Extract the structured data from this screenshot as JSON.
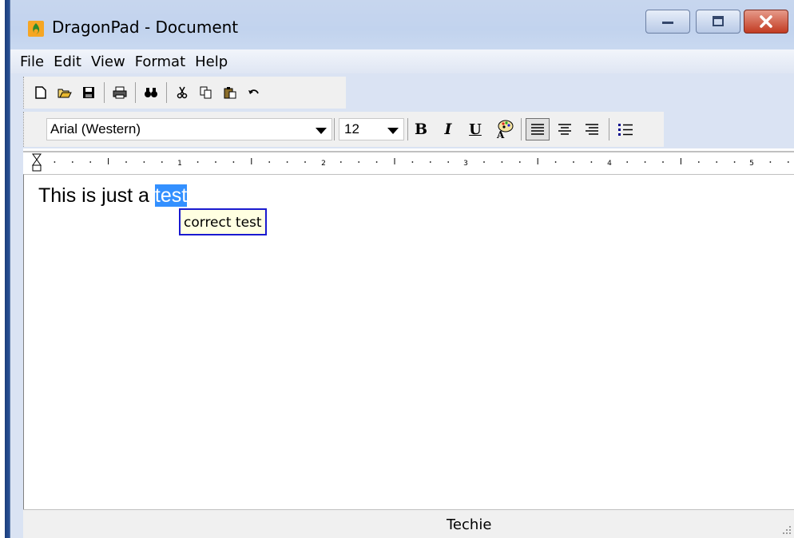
{
  "window": {
    "title": "DragonPad - Document"
  },
  "menu": [
    "File",
    "Edit",
    "View",
    "Format",
    "Help"
  ],
  "toolbar": {
    "icons": [
      "new-file-icon",
      "open-folder-icon",
      "save-icon",
      "print-icon",
      "find-icon",
      "cut-icon",
      "copy-icon",
      "paste-icon",
      "undo-icon"
    ]
  },
  "format_bar": {
    "font_name": "Arial (Western)",
    "font_size": "12",
    "bold_label": "B",
    "italic_label": "I",
    "underline_label": "U"
  },
  "ruler": {
    "labels": [
      "1",
      "2",
      "3",
      "4",
      "5"
    ]
  },
  "document": {
    "text_before": "This is just a ",
    "selected_word": "test"
  },
  "suggestion": {
    "label": "correct test"
  },
  "status": {
    "text": "Techie"
  },
  "colors": {
    "selection": "#3390ff",
    "suggestion_border": "#1a1ad0",
    "suggestion_bg": "#ffffe1",
    "close_button": "#c23b22"
  }
}
